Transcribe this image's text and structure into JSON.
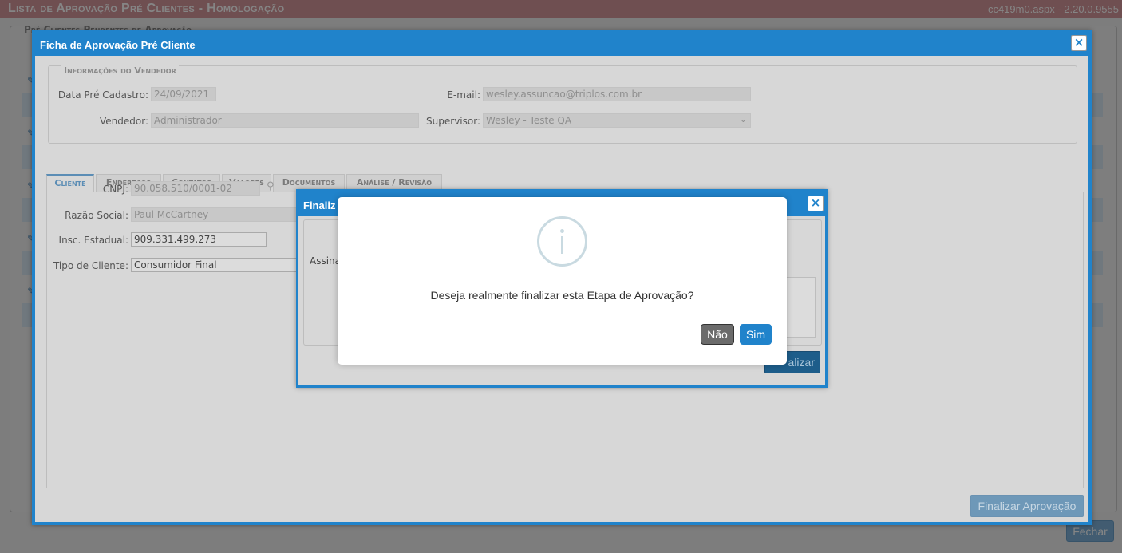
{
  "app": {
    "title": "Lista de Aprovação Pré Clientes  - Homologação",
    "version": "cc419m0.aspx - 2.20.0.9555",
    "panel_legend": "Pré Clientes Pendentes de Aprovação",
    "fechar_label": "Fechar"
  },
  "dialog": {
    "title": "Ficha de Aprovação Pré Cliente",
    "close_icon": "×",
    "vendor_section": {
      "legend": "Informações do Vendedor",
      "data_label": "Data Pré Cadastro:",
      "data_value": "24/09/2021",
      "email_label": "E-mail:",
      "email_value": "wesley.assuncao@triplos.com.br",
      "vendedor_label": "Vendedor:",
      "vendedor_value": "Administrador",
      "supervisor_label": "Supervisor:",
      "supervisor_value": "Wesley - Teste QA"
    },
    "tabs": [
      "Cliente",
      "Endereços",
      "Contatos",
      "Valores",
      "Documentos",
      "Análise / Revisão"
    ],
    "cliente": {
      "cnpj_label": "CNPJ:",
      "cnpj_value": "90.058.510/0001-02",
      "razao_label": "Razão Social:",
      "razao_value": "Paul McCartney",
      "insc_label": "Insc. Estadual:",
      "insc_value": "909.331.499.273",
      "tipo_label": "Tipo de Cliente:",
      "tipo_value": "Consumidor Final"
    },
    "finalizar_aprovacao_label": "Finalizar Aprovação"
  },
  "dialog2": {
    "title": "Finaliz",
    "label": "Assina",
    "button_label": "alizar",
    "close_icon": "×"
  },
  "confirm": {
    "message": "Deseja realmente finalizar esta Etapa de Aprovação?",
    "no_label": "Não",
    "yes_label": "Sim",
    "icon": "info-icon"
  },
  "colors": {
    "accent": "#2083cb",
    "topbar": "#d5989c"
  }
}
